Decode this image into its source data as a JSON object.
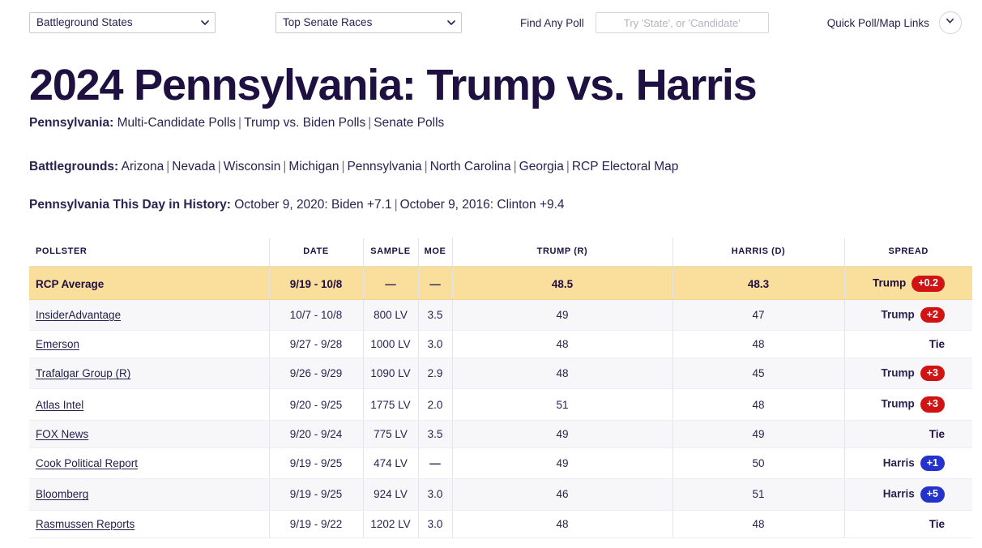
{
  "topbar": {
    "state_select": {
      "selected": "Battleground States",
      "options": [
        "Battleground States"
      ]
    },
    "race_select": {
      "selected": "Top Senate Races",
      "options": [
        "Top Senate Races"
      ]
    },
    "find_any_poll_label": "Find Any Poll",
    "search_placeholder": "Try 'State', or 'Candidate'",
    "search_value": "",
    "quick_links_label": "Quick Poll/Map Links",
    "expand_icon": "chevron-down-icon"
  },
  "headline": {
    "title": "2024 Pennsylvania: Trump vs. Harris"
  },
  "state_links": {
    "label": "Pennsylvania:",
    "items": [
      "Multi-Candidate Polls",
      "Trump vs. Biden Polls",
      "Senate Polls"
    ]
  },
  "battlegrounds": {
    "label": "Battlegrounds:",
    "items": [
      "Arizona",
      "Nevada",
      "Wisconsin",
      "Michigan",
      "Pennsylvania",
      "North Carolina",
      "Georgia",
      "RCP Electoral Map"
    ]
  },
  "history": {
    "label": "Pennsylvania This Day in History:",
    "items": [
      "October 9, 2020: Biden +7.1",
      "October 9, 2016: Clinton +9.4"
    ]
  },
  "table": {
    "columns": [
      "Pollster",
      "Date",
      "Sample",
      "MOE",
      "Trump (R)",
      "Harris (D)",
      "Spread"
    ],
    "average": {
      "pollster": "RCP Average",
      "date": "9/19 - 10/8",
      "sample": "—",
      "moe": "—",
      "trump": "48.5",
      "harris": "48.3",
      "spread_leader": "Trump",
      "spread_value": "+0.2",
      "spread_party": "rep"
    },
    "rows": [
      {
        "pollster": "InsiderAdvantage",
        "date": "10/7 - 10/8",
        "sample": "800 LV",
        "moe": "3.5",
        "trump": "49",
        "harris": "47",
        "spread_leader": "Trump",
        "spread_value": "+2",
        "spread_party": "rep"
      },
      {
        "pollster": "Emerson",
        "date": "9/27 - 9/28",
        "sample": "1000 LV",
        "moe": "3.0",
        "trump": "48",
        "harris": "48",
        "spread_leader": "Tie",
        "spread_value": "",
        "spread_party": "tie"
      },
      {
        "pollster": "Trafalgar Group (R)",
        "date": "9/26 - 9/29",
        "sample": "1090 LV",
        "moe": "2.9",
        "trump": "48",
        "harris": "45",
        "spread_leader": "Trump",
        "spread_value": "+3",
        "spread_party": "rep"
      },
      {
        "pollster": "Atlas Intel",
        "date": "9/20 - 9/25",
        "sample": "1775 LV",
        "moe": "2.0",
        "trump": "51",
        "harris": "48",
        "spread_leader": "Trump",
        "spread_value": "+3",
        "spread_party": "rep"
      },
      {
        "pollster": "FOX News",
        "date": "9/20 - 9/24",
        "sample": "775 LV",
        "moe": "3.5",
        "trump": "49",
        "harris": "49",
        "spread_leader": "Tie",
        "spread_value": "",
        "spread_party": "tie"
      },
      {
        "pollster": "Cook Political Report",
        "date": "9/19 - 9/25",
        "sample": "474 LV",
        "moe": "—",
        "trump": "49",
        "harris": "50",
        "spread_leader": "Harris",
        "spread_value": "+1",
        "spread_party": "dem"
      },
      {
        "pollster": "Bloomberg",
        "date": "9/19 - 9/25",
        "sample": "924 LV",
        "moe": "3.0",
        "trump": "46",
        "harris": "51",
        "spread_leader": "Harris",
        "spread_value": "+5",
        "spread_party": "dem"
      },
      {
        "pollster": "Rasmussen Reports",
        "date": "9/19 - 9/22",
        "sample": "1202 LV",
        "moe": "3.0",
        "trump": "48",
        "harris": "48",
        "spread_leader": "Tie",
        "spread_value": "",
        "spread_party": "tie"
      }
    ]
  },
  "colors": {
    "title": "#1e1040",
    "average_row_bg": "#fade9c",
    "republican": "#d01414",
    "democrat": "#2433cc"
  }
}
